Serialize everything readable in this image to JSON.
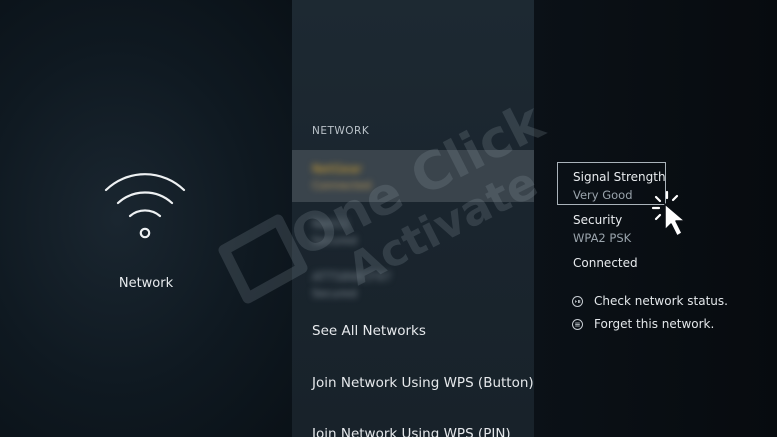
{
  "left": {
    "icon": "wifi-icon",
    "label": "Network"
  },
  "networks": {
    "header": "NETWORK",
    "items": [
      {
        "name": "NetGear",
        "subtitle": "Connected"
      },
      {
        "name": "NetG1",
        "subtitle": "Secured"
      },
      {
        "name": "ATT58WCF97",
        "subtitle": "Secured"
      }
    ],
    "see_all": "See All Networks",
    "wps_button": "Join Network Using WPS (Button)",
    "wps_pin": "Join Network Using WPS (PIN)"
  },
  "details": {
    "signal_label": "Signal Strength",
    "signal_value": "Very Good",
    "security_label": "Security",
    "security_value": "WPA2 PSK",
    "status": "Connected",
    "actions": [
      {
        "icon": "play-pause-icon",
        "label": "Check network status."
      },
      {
        "icon": "menu-icon",
        "label": "Forget this network."
      }
    ]
  },
  "colors": {
    "selected_name": "#d9a530",
    "selected_bg": "#3a444c",
    "watermark": "#8e99a3"
  },
  "watermark": {
    "line1": "One Click",
    "line2": "Activate"
  }
}
